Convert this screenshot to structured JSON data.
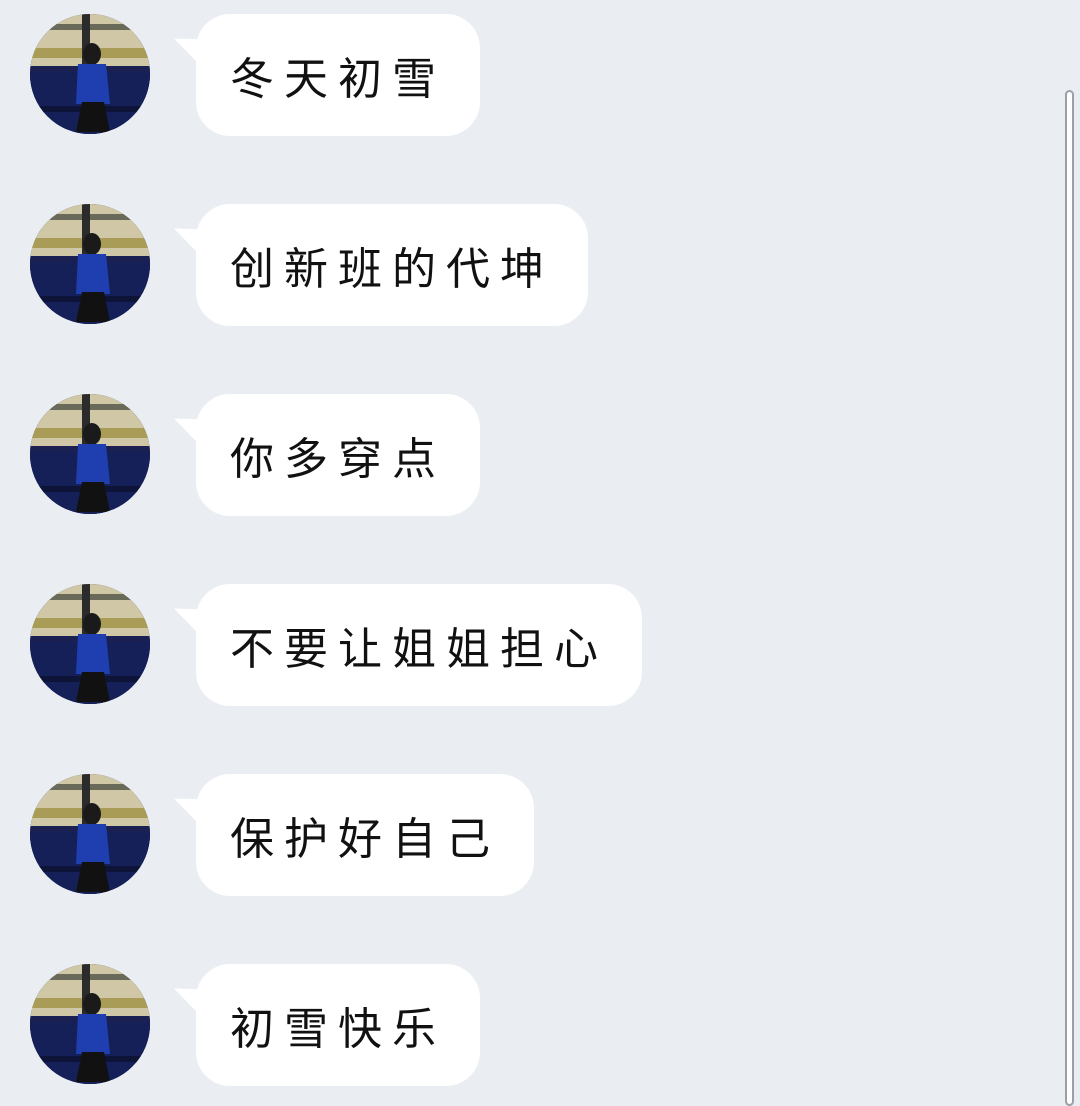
{
  "messages": [
    {
      "text": "冬天初雪"
    },
    {
      "text": "创新班的代坤"
    },
    {
      "text": "你多穿点"
    },
    {
      "text": "不要让姐姐担心"
    },
    {
      "text": "保护好自己"
    },
    {
      "text": "初雪快乐"
    }
  ],
  "colors": {
    "background": "#eaeef3",
    "bubble": "#ffffff",
    "text": "#111111"
  }
}
